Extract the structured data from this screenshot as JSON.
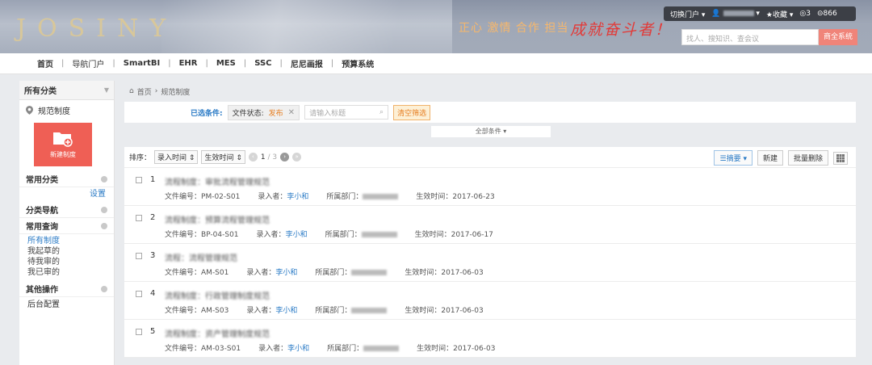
{
  "header": {
    "logo": "JOSINY",
    "slogan_left": "正心 激情 合作 担当",
    "slogan_right": "成就奋斗者！",
    "userbar": {
      "switch_portal": "切换门户",
      "favorites": "收藏",
      "count1": "3",
      "count2": "866"
    },
    "search_placeholder": "找人、搜知识、查会议",
    "search_button": "商全系统"
  },
  "nav": {
    "items": [
      "首页",
      "导航门户",
      "SmartBI",
      "EHR",
      "MES",
      "SSC",
      "尼尼画报",
      "预算系统"
    ]
  },
  "sidebar": {
    "category_select": "所有分类",
    "location": "规范制度",
    "new_button": "新建制度",
    "common_category": "常用分类",
    "settings": "设置",
    "category_nav": "分类导航",
    "common_query": "常用查询",
    "queries": [
      "所有制度",
      "我起草的",
      "待我审的",
      "我已审的"
    ],
    "other_ops": "其他操作",
    "backend": "后台配置"
  },
  "breadcrumb": {
    "home": "首页",
    "sep": "›",
    "current": "规范制度"
  },
  "filter": {
    "label": "已选条件:",
    "chip_key": "文件状态:",
    "chip_value": "发布",
    "input_placeholder": "请输入标题",
    "clear_button": "清空筛选",
    "all_conditions": "全部条件"
  },
  "toolbar": {
    "sort_label": "排序：",
    "sort1": "录入时间",
    "sort2": "生效时间",
    "page_current": "1",
    "page_total": "3",
    "summary_button": "摘要",
    "new_button": "新建",
    "batch_delete": "批量删除"
  },
  "rows": [
    {
      "num": "1",
      "title": "流程制度：审批流程管理规范",
      "code_label": "文件编号：",
      "code": "PM-02-S01",
      "author_label": "录入者：",
      "author": "李小和",
      "dept_label": "所属部门：",
      "date_label": "生效时间：",
      "date": "2017-06-23"
    },
    {
      "num": "2",
      "title": "流程制度：预算流程管理规范",
      "code_label": "文件编号：",
      "code": "BP-04-S01",
      "author_label": "录入者：",
      "author": "李小和",
      "dept_label": "所属部门：",
      "date_label": "生效时间：",
      "date": "2017-06-17"
    },
    {
      "num": "3",
      "title": "流程：流程管理规范",
      "code_label": "文件编号：",
      "code": "AM-S01",
      "author_label": "录入者：",
      "author": "李小和",
      "dept_label": "所属部门：",
      "date_label": "生效时间：",
      "date": "2017-06-03"
    },
    {
      "num": "4",
      "title": "流程制度：行政管理制度规范",
      "code_label": "文件编号：",
      "code": "AM-S03",
      "author_label": "录入者：",
      "author": "李小和",
      "dept_label": "所属部门：",
      "date_label": "生效时间：",
      "date": "2017-06-03"
    },
    {
      "num": "5",
      "title": "流程制度：资产管理制度规范",
      "code_label": "文件编号：",
      "code": "AM-03-S01",
      "author_label": "录入者：",
      "author": "李小和",
      "dept_label": "所属部门：",
      "date_label": "生效时间：",
      "date": "2017-06-03"
    }
  ]
}
